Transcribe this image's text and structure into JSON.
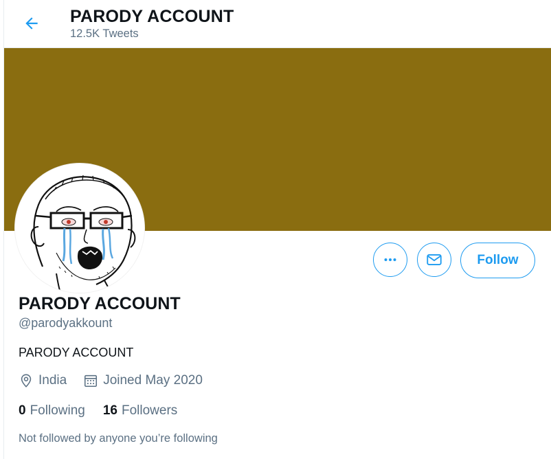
{
  "header": {
    "title": "PARODY ACCOUNT",
    "tweet_count": "12.5K Tweets",
    "back_icon": "arrow-left-icon"
  },
  "banner": {
    "color": "#8a6d10"
  },
  "avatar": {
    "description_icon": "crying-wojak-avatar"
  },
  "actions": {
    "more_icon": "more-dots-icon",
    "message_icon": "envelope-icon",
    "follow_label": "Follow",
    "accent_color": "#1d9bf0"
  },
  "profile": {
    "name": "PARODY ACCOUNT",
    "handle": "@parodyakkount",
    "bio": "PARODY ACCOUNT",
    "location": "India",
    "location_icon": "location-pin-icon",
    "joined": "Joined May 2020",
    "joined_icon": "calendar-icon"
  },
  "stats": {
    "following_count": "0",
    "following_label": "Following",
    "followers_count": "16",
    "followers_label": "Followers"
  },
  "footer_note": "Not followed by anyone you’re following"
}
